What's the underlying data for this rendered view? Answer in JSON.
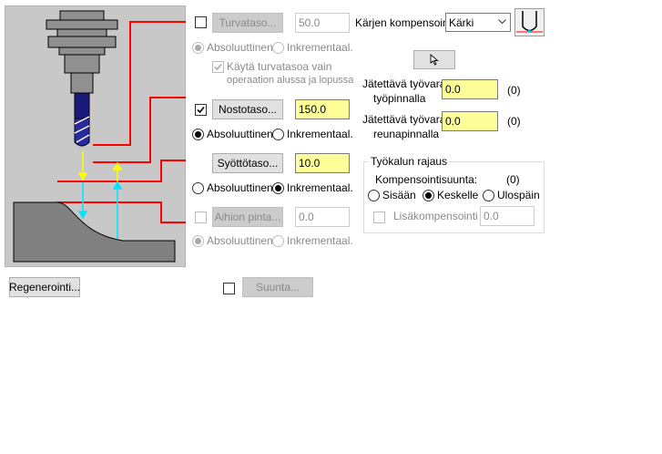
{
  "diagram": {
    "colors": {
      "background": "#c8c8c8",
      "stock": "#808080",
      "levels": "#ff0000",
      "feed_arrow": "#ffff00",
      "rapid_arrow": "#00ffff"
    }
  },
  "clearance": {
    "button_label": "Turvataso...",
    "value": "50.0",
    "checked": false,
    "enabled": false,
    "mode_absolute": "Absoluuttinen",
    "mode_incremental": "Inkrementaal.",
    "only_start_end_label": "Käytä turvatasoa vain",
    "only_start_end_label2": "operaation alussa ja lopussa"
  },
  "retract": {
    "button_label": "Nostotaso...",
    "value": "150.0",
    "checked": true,
    "mode_absolute": "Absoluuttinen",
    "mode_incremental": "Inkrementaal."
  },
  "feed": {
    "button_label": "Syöttötaso...",
    "value": "10.0",
    "mode_absolute": "Absoluuttinen",
    "mode_incremental": "Inkrementaal."
  },
  "stock_top": {
    "button_label": "Aihion pinta...",
    "value": "0.0",
    "mode_absolute": "Absoluuttinen",
    "mode_incremental": "Inkrementaal."
  },
  "regen_button": "Regenerointi...",
  "direction": {
    "button_label": "Suunta..."
  },
  "tip_comp": {
    "label": "Kärjen kompensointi",
    "selected": "Kärki"
  },
  "stock_to_leave": {
    "floor_label1": "Jätettävä työvara",
    "floor_label2": "työpinnalla",
    "floor_value": "0.0",
    "floor_extra": "(0)",
    "wall_label1": "Jätettävä työvara",
    "wall_label2": "reunapinnalla",
    "wall_value": "0.0",
    "wall_extra": "(0)"
  },
  "containment": {
    "title": "Työkalun rajaus",
    "comp_dir_label": "Kompensointisuunta:",
    "comp_dir_value": "(0)",
    "inside": "Sisään",
    "center": "Keskelle",
    "outside": "Ulospäin",
    "additional_label": "Lisäkompensointi",
    "additional_value": "0.0"
  }
}
